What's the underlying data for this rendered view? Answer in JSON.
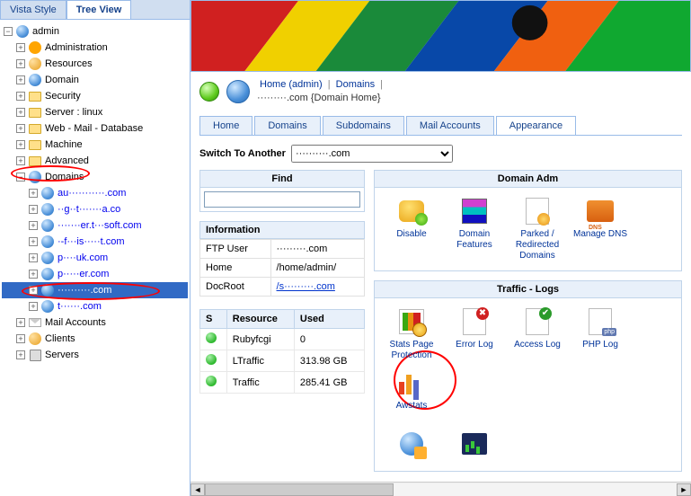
{
  "tree": {
    "tabs": [
      "Vista Style",
      "Tree View"
    ],
    "active_tab": 1,
    "root": "admin",
    "items": [
      "Administration",
      "Resources",
      "Domain",
      "Security",
      "Server : linux",
      "Web - Mail - Database",
      "Machine",
      "Advanced",
      "Domains"
    ],
    "domains": [
      "au···········.com",
      "··g··t·······a.co",
      "·······er.t···soft.com",
      "·-f···is·····t.com",
      "p····uk.com",
      "p·····er.com",
      "··········.com",
      "t······.com"
    ],
    "tail": [
      "Mail Accounts",
      "Clients",
      "Servers"
    ]
  },
  "breadcrumbs": {
    "home": "Home (admin)",
    "domains": "Domains",
    "title": "·········.com {Domain Home}"
  },
  "main_tabs": [
    "Home",
    "Domains",
    "Subdomains",
    "Mail Accounts",
    "Appearance"
  ],
  "switch": {
    "label": "Switch To Another",
    "value": "··········.com"
  },
  "find": {
    "head": "Find",
    "value": ""
  },
  "info": {
    "head": "Information",
    "rows": [
      {
        "k": "FTP User",
        "v": "·········.com"
      },
      {
        "k": "Home",
        "v": "/home/admin/"
      },
      {
        "k": "DocRoot",
        "v": "/s·········.com"
      }
    ]
  },
  "resources": {
    "cols": [
      "S",
      "Resource",
      "Used"
    ],
    "rows": [
      {
        "name": "Rubyfcgi",
        "used": "0"
      },
      {
        "name": "LTraffic",
        "used": "313.98 GB"
      },
      {
        "name": "Traffic",
        "used": "285.41 GB"
      }
    ]
  },
  "adm": {
    "head": "Domain Adm",
    "items": [
      "Disable",
      "Domain Features",
      "Parked / Redirected Domains",
      "Manage DNS"
    ]
  },
  "logs": {
    "head": "Traffic - Logs",
    "items": [
      "Stats Page Protection",
      "Error Log",
      "Access Log",
      "PHP Log",
      "Awstats"
    ]
  }
}
